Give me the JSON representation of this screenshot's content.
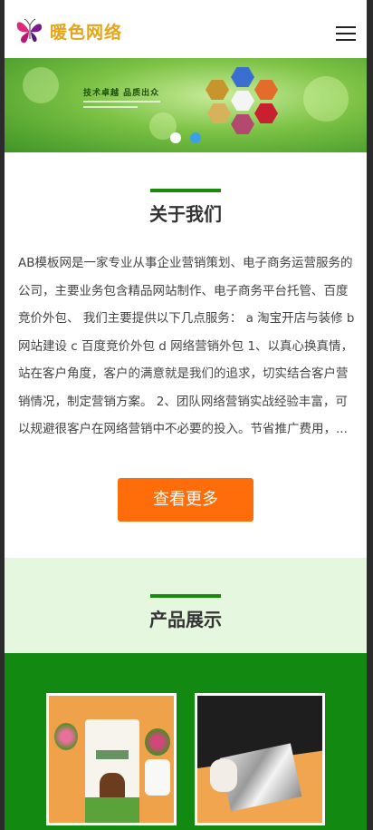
{
  "header": {
    "brand_name": "暖色网络",
    "logo_icon": "butterfly-logo-icon",
    "menu_icon": "hamburger-menu-icon"
  },
  "banner": {
    "slogan": "技术卓越  品质出众",
    "slides_total": 2,
    "active_slide": 2
  },
  "about": {
    "title": "关于我们",
    "body": "AB模板网是一家专业从事企业营销策划、电子商务运营服务的公司，主要业务包含精品网站制作、电子商务平台托管、百度竞价外包、 我们主要提供以下几点服务： a 淘宝开店与装修 b 网站建设 c 百度竞价外包 d 网络营销外包 1、以真心换真情，站在客户角度，客户的满意就是我们的追求，切实结合客户营销情况，制定营销方案。 2、团队网络营销实战经验丰富，可以规避很客户在网络营销中不必要的投入。节省推广费用，...",
    "more_button": "查看更多"
  },
  "products": {
    "title": "产品展示"
  },
  "colors": {
    "accent_green": "#1a8a0c",
    "button_orange": "#ff6c0a",
    "products_bg": "#128a12",
    "products_head_bg": "#e6f7e0",
    "dot_active": "#3ba0e6"
  }
}
